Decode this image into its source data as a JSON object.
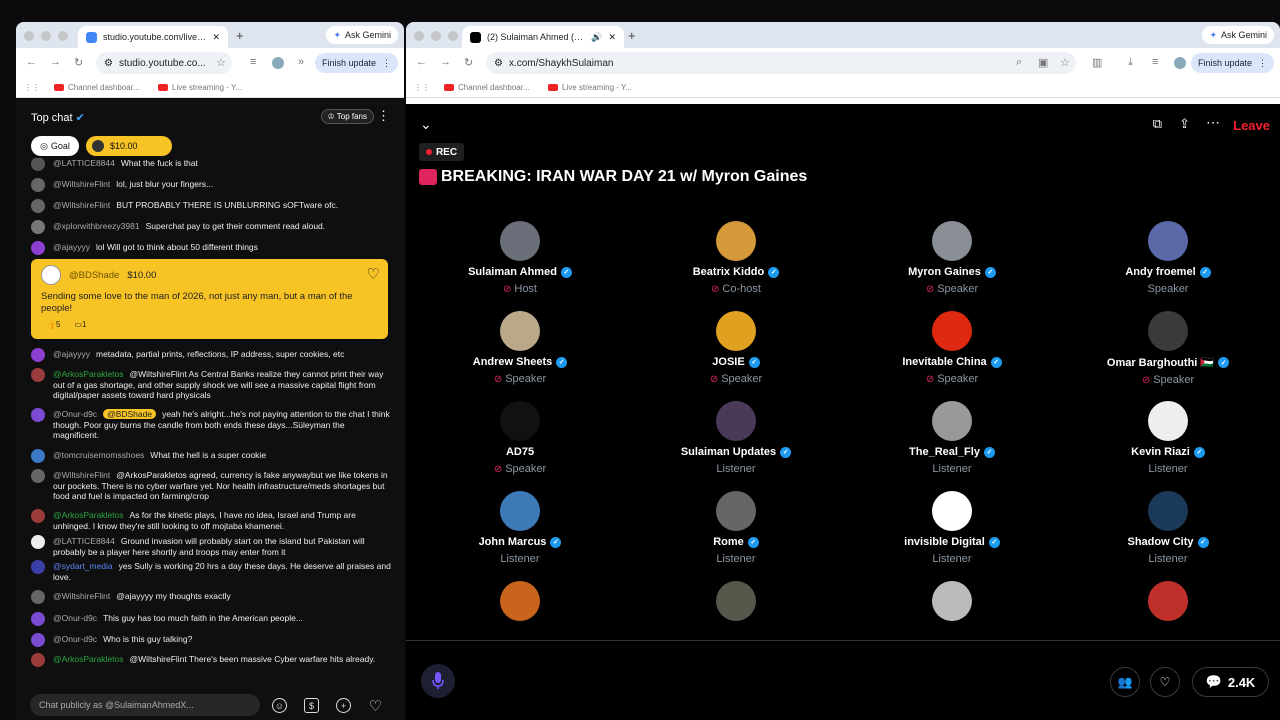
{
  "left_window": {
    "tab_title": "studio.youtube.com/live_chat",
    "ask_gemini": "Ask Gemini",
    "url": "studio.youtube.co...",
    "finish_update": "Finish update",
    "bookmarks": [
      "Channel dashboar...",
      "Live streaming - Y..."
    ]
  },
  "chat": {
    "title": "Top chat",
    "top_fans": "Top fans",
    "goal_chip": "Goal",
    "amount_chip": "$10.00",
    "messages": [
      {
        "name": "@LATTICE8844",
        "text": "What the fuck is that"
      },
      {
        "name": "@WiltshireFlint",
        "text": "lol, just blur your fingers..."
      },
      {
        "name": "@WiltshireFlint",
        "text": "BUT PROBABLY THERE IS UNBLURRING sOFTware ofc."
      },
      {
        "name": "@xplorwithbreezy3981",
        "text": "Superchat pay to get their comment read aloud."
      },
      {
        "name": "@ajayyyy",
        "text": "lol Will got to think about 50 different things"
      },
      {
        "name": "@ajayyyy",
        "text": "metadata, partial prints, reflections, IP address, super cookies, etc"
      },
      {
        "name": "@ArkosParakletos",
        "text": "@WiltshireFlint As Central Banks realize they cannot print their way out of a gas shortage, and other supply shock we will see a massive capital flight from digital/paper assets toward hard physicals"
      },
      {
        "name": "@Onur-d9c",
        "badge": "@BDShade",
        "text": "yeah he's alright...he's not paying attention to the chat I think though. Poor guy burns the candle from both ends these days...Süleyman the magnificent."
      },
      {
        "name": "@tomcruisemomsshoes",
        "text": "What the hell is a super cookie"
      },
      {
        "name": "@WiltshireFlint",
        "text": "@ArkosParakletos agreed, currency is fake anywaybut we like tokens in our pockets. There is no cyber warfare yet. Nor health infrastructure/meds shortages but food and fuel is impacted on farming/crop"
      },
      {
        "name": "@ArkosParakletos",
        "text": "As for the kinetic plays, I have no idea, Israel and Trump are unhinged. I know they're still looking to off mojtaba khamenei."
      },
      {
        "name": "@LATTICE8844",
        "text": "Ground invasion will probably start on the island but Pakistan will probably be a player here shortly and troops may enter from it"
      },
      {
        "name": "@sydart_media",
        "text": "yes Sully is working 20 hrs a day these days. He deserve all praises and love."
      },
      {
        "name": "@WiltshireFlint",
        "text": "@ajayyyy my thoughts exactly"
      },
      {
        "name": "@Onur-d9c",
        "text": "This guy has too much faith in the American people..."
      },
      {
        "name": "@Onur-d9c",
        "text": "Who is this guy talking?"
      },
      {
        "name": "@ArkosParakletos",
        "text": "@WiltshireFlint There's been massive Cyber warfare hits already."
      }
    ],
    "superchat": {
      "name": "@BDShade",
      "amount": "$10.00",
      "text": "Sending some love to the man of 2026, not just any man, but a man of the people!",
      "likes": "5",
      "replies": "1"
    },
    "composer_placeholder": "Chat publicly as @SulaimanAhmedX..."
  },
  "right_window": {
    "tab_title": "(2) Sulaiman Ahmed (@Sl",
    "ask_gemini": "Ask Gemini",
    "url": "x.com/ShaykhSulaiman",
    "finish_update": "Finish update",
    "bookmarks": [
      "Channel dashboar...",
      "Live streaming - Y..."
    ]
  },
  "space": {
    "leave": "Leave",
    "rec": "REC",
    "title": "BREAKING: IRAN WAR DAY 21 w/ Myron Gaines",
    "listener_count": "2.4K",
    "people": [
      {
        "name": "Sulaiman Ahmed",
        "role": "Host",
        "muted": true,
        "verified": true,
        "color": "#6b6f7a"
      },
      {
        "name": "Beatrix Kiddo",
        "role": "Co-host",
        "muted": true,
        "verified": true,
        "color": "#d49a3a"
      },
      {
        "name": "Myron Gaines",
        "role": "Speaker",
        "muted": true,
        "verified": true,
        "color": "#8a8f96"
      },
      {
        "name": "Andy froemel",
        "role": "Speaker",
        "muted": false,
        "verified": true,
        "color": "#5a6aa8"
      },
      {
        "name": "Andrew Sheets",
        "role": "Speaker",
        "muted": true,
        "verified": true,
        "color": "#b9a98a"
      },
      {
        "name": "JOSIE",
        "role": "Speaker",
        "muted": true,
        "verified": true,
        "color": "#e0a020"
      },
      {
        "name": "Inevitable China",
        "role": "Speaker",
        "muted": true,
        "verified": true,
        "color": "#de2910"
      },
      {
        "name": "Omar Barghouthi 🇵🇸",
        "role": "Speaker",
        "muted": true,
        "verified": true,
        "color": "#3a3a3a"
      },
      {
        "name": "AD75",
        "role": "Speaker",
        "muted": true,
        "verified": false,
        "color": "#111111"
      },
      {
        "name": "Sulaiman Updates",
        "role": "Listener",
        "muted": false,
        "verified": true,
        "color": "#4a3a5a"
      },
      {
        "name": "The_Real_Fly",
        "role": "Listener",
        "muted": false,
        "verified": true,
        "color": "#999999"
      },
      {
        "name": "Kevin Riazi",
        "role": "Listener",
        "muted": false,
        "verified": true,
        "color": "#eeeeee"
      },
      {
        "name": "John Marcus",
        "role": "Listener",
        "muted": false,
        "verified": true,
        "color": "#3f7ab8"
      },
      {
        "name": "Rome",
        "role": "Listener",
        "muted": false,
        "verified": true,
        "color": "#666666"
      },
      {
        "name": "invisible Digital",
        "role": "Listener",
        "muted": false,
        "verified": true,
        "color": "#ffffff"
      },
      {
        "name": "Shadow City",
        "role": "Listener",
        "muted": false,
        "verified": true,
        "color": "#1b3a5a"
      },
      {
        "name": "",
        "role": "",
        "muted": false,
        "verified": false,
        "color": "#c8641c"
      },
      {
        "name": "",
        "role": "",
        "muted": false,
        "verified": false,
        "color": "#55584a"
      },
      {
        "name": "",
        "role": "",
        "muted": false,
        "verified": false,
        "color": "#bbbbbb"
      },
      {
        "name": "",
        "role": "",
        "muted": false,
        "verified": false,
        "color": "#c0302a"
      }
    ]
  }
}
